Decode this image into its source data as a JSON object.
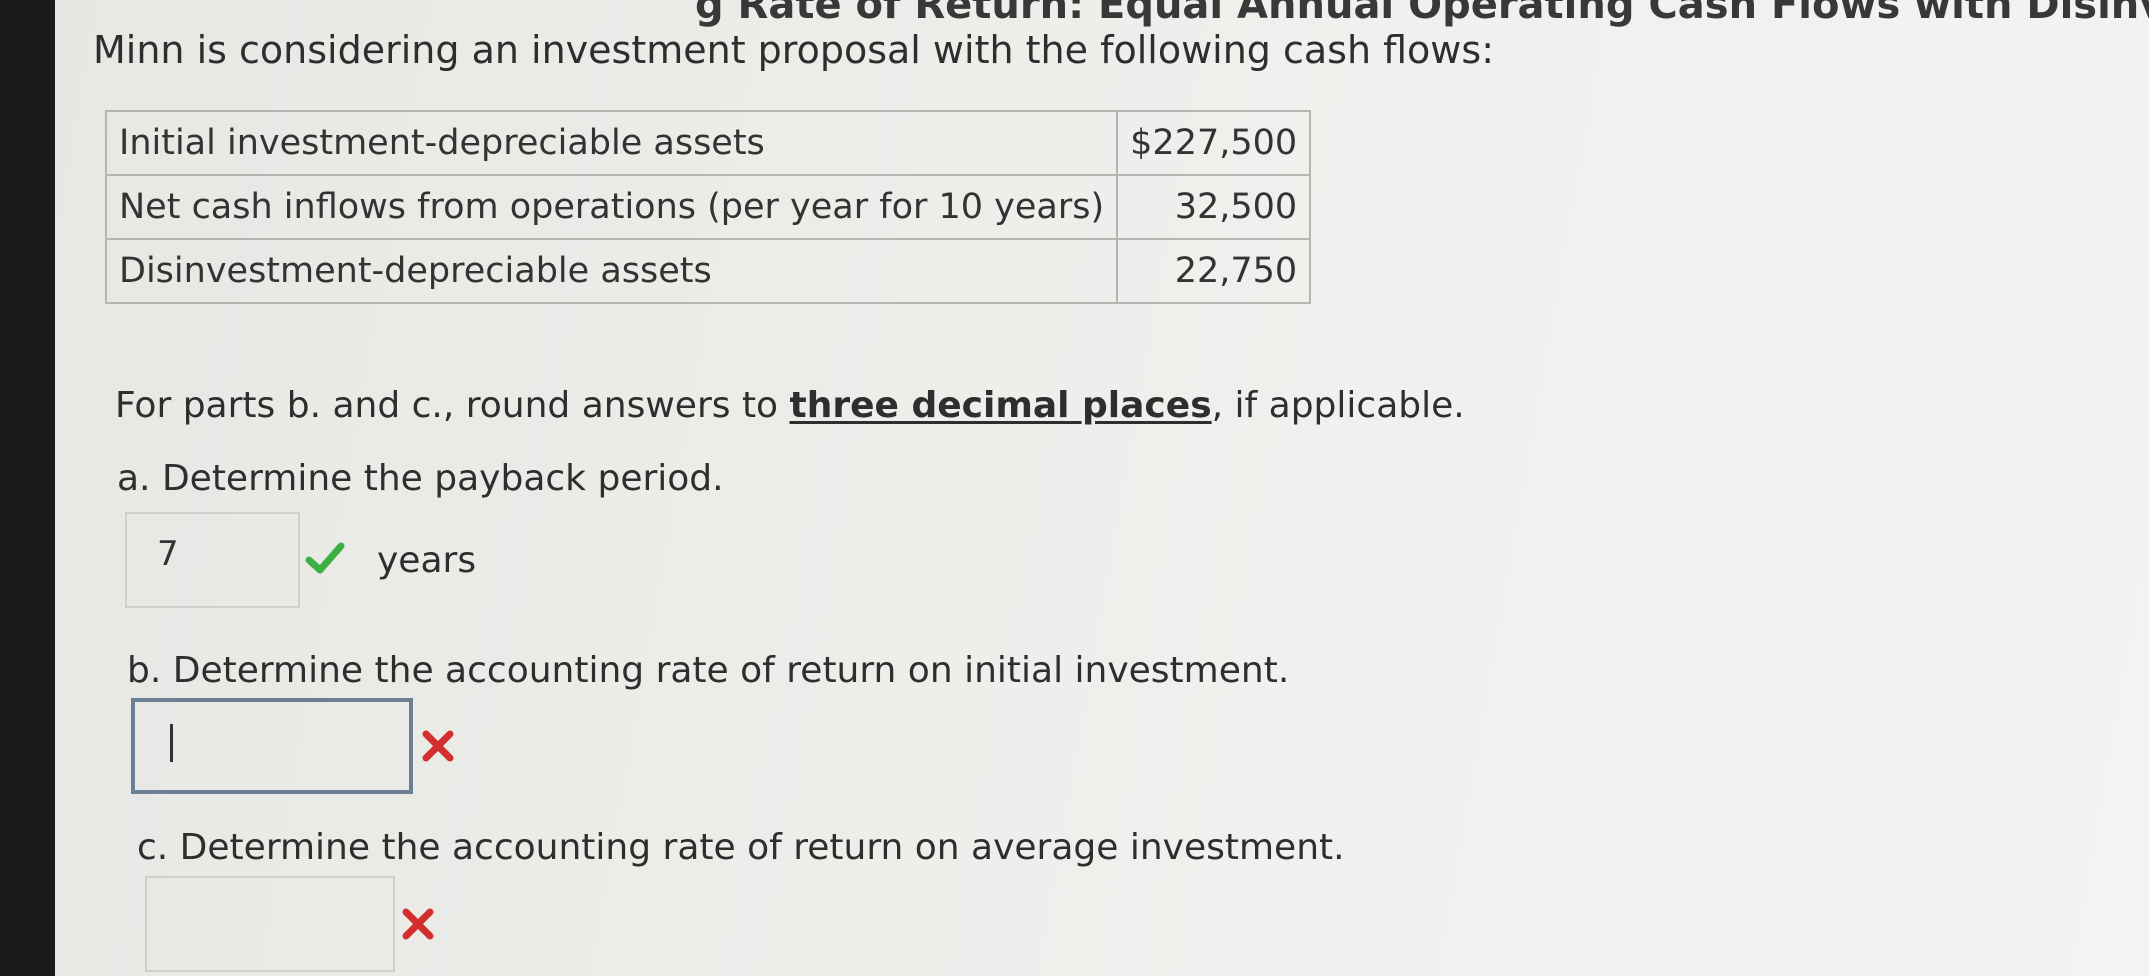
{
  "problem": {
    "banner": "g Rate of Return: Equal Annual Operating Cash Flows with Disinvestment",
    "intro": "Minn is considering an investment proposal with the following cash flows:"
  },
  "cash_flows": [
    {
      "label": "Initial investment-depreciable assets",
      "amount": "$227,500"
    },
    {
      "label": "Net cash inflows from operations (per year for 10 years)",
      "amount": "32,500"
    },
    {
      "label": "Disinvestment-depreciable assets",
      "amount": "22,750"
    }
  ],
  "instruction": {
    "prefix": "For parts b. and c., round answers to ",
    "emphasis": "three decimal places",
    "suffix": ", if applicable."
  },
  "part_a": {
    "question": "a. Determine the payback period.",
    "answer": "7",
    "unit": "years",
    "status": "correct"
  },
  "part_b": {
    "question": "b. Determine the accounting rate of return on initial investment.",
    "answer": "",
    "status": "incorrect"
  },
  "part_c": {
    "question": "c. Determine the accounting rate of return on average investment.",
    "answer": "",
    "status": "incorrect"
  },
  "colors": {
    "correct": "#3cb043",
    "incorrect": "#d32f2f"
  }
}
